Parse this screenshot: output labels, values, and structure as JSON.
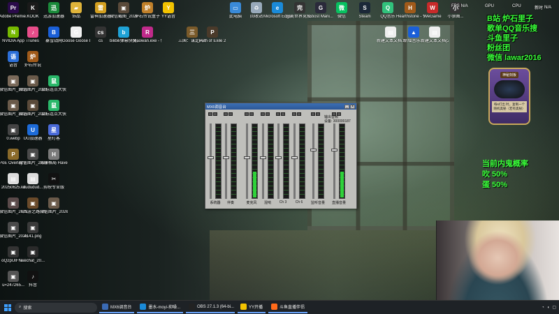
{
  "desktop_icons_col1": [
    {
      "label": "Adobe Premie...",
      "icon": "premiere-icon",
      "color": "#2a0a4a",
      "glyph": "Pr"
    },
    {
      "label": "NVIDIA App",
      "icon": "nvidia-icon",
      "color": "#76b900",
      "glyph": "N"
    },
    {
      "label": "语音",
      "icon": "voice-icon",
      "color": "#2c6fd8",
      "glyph": "语"
    },
    {
      "label": "微信图片_2025072...",
      "icon": "image-icon",
      "color": "#7a6a5a",
      "glyph": "▣"
    },
    {
      "label": "微信图片_2025072...",
      "icon": "image-icon",
      "color": "#6a5a4a",
      "glyph": "▣"
    },
    {
      "label": "0.webp",
      "icon": "webp-icon",
      "color": "#444",
      "glyph": "▣"
    },
    {
      "label": "PoE Overlay II Standal...",
      "icon": "poe-overlay-icon",
      "color": "#8a6a2a",
      "glyph": "P"
    },
    {
      "label": "20250625.kx",
      "icon": "file-icon",
      "color": "#ddd",
      "glyph": "▤"
    },
    {
      "label": "微信图片_2025062...",
      "icon": "image-icon",
      "color": "#5a4a4a",
      "glyph": "▣"
    },
    {
      "label": "微信图片_2025091...",
      "icon": "image-icon",
      "color": "#4a4a4a",
      "glyph": "▣"
    },
    {
      "label": "oQ2pUIFN...",
      "icon": "image-icon",
      "color": "#333",
      "glyph": "▣"
    },
    {
      "label": "u=247265...",
      "icon": "image-icon",
      "color": "#555",
      "glyph": "▣"
    }
  ],
  "desktop_icons_col2": [
    {
      "label": "KOOK",
      "icon": "kook-icon",
      "color": "#1a1a1a",
      "glyph": "K"
    },
    {
      "label": "iTunes",
      "icon": "itunes-icon",
      "color": "#e84d8a",
      "glyph": "♪"
    },
    {
      "label": "炉石传说",
      "icon": "hearthstone-icon",
      "color": "#a05a1a",
      "glyph": "炉"
    },
    {
      "label": "微信图片_2025072...",
      "icon": "image-icon",
      "color": "#6a5a4a",
      "glyph": "▣"
    },
    {
      "label": "微信图片_2025072...",
      "icon": "image-icon",
      "color": "#5a4a3a",
      "glyph": "▣"
    },
    {
      "label": "UU加速器",
      "icon": "uu-accelerator-icon",
      "color": "#1d6bd8",
      "glyph": "U"
    },
    {
      "label": "微信图片_2025071...",
      "icon": "image-icon",
      "color": "#4a4a4a",
      "glyph": "▣"
    },
    {
      "label": "dududud...",
      "icon": "file-icon",
      "color": "#ddd",
      "glyph": "▤"
    },
    {
      "label": "《西游之路: 降临》预先...",
      "icon": "image-icon",
      "color": "#6a4a2a",
      "glyph": "▣"
    },
    {
      "label": "4141.png",
      "icon": "image-icon",
      "color": "#3a3a3a",
      "glyph": "▣"
    },
    {
      "label": "wechat_20...",
      "icon": "image-icon",
      "color": "#2a2a2a",
      "glyph": "▣"
    },
    {
      "label": "抖音",
      "icon": "douyin-icon",
      "color": "#111",
      "glyph": "♪"
    }
  ],
  "desktop_icons_col3": [
    {
      "label": "迅游加速器",
      "icon": "xunyou-icon",
      "color": "#1a8a3a",
      "glyph": "迅"
    },
    {
      "label": "暴雪战网",
      "icon": "battlenet-icon",
      "color": "#1a5fd8",
      "glyph": "B"
    },
    {
      "label": "鼠标连点大侠",
      "icon": "mouse-clicker-icon",
      "color": "#2ab86a",
      "glyph": "鼠"
    },
    {
      "label": "鼠标连点大侠",
      "icon": "mouse-clicker-icon",
      "color": "#2ab86a",
      "glyph": "鼠"
    },
    {
      "label": "星盯客",
      "icon": "app-icon",
      "color": "#4a6ad8",
      "glyph": "星"
    },
    {
      "label": "海康格局 Havendock",
      "icon": "havendock-icon",
      "color": "#7a7a7a",
      "glyph": "H"
    },
    {
      "label": "剪映专业版",
      "icon": "capcut-icon",
      "color": "#111",
      "glyph": "✂"
    },
    {
      "label": "微信图片_2026022...",
      "icon": "image-icon",
      "color": "#6a5a4a",
      "glyph": "▣"
    }
  ],
  "desktop_icons_row_top": [
    {
      "label": "饰品",
      "icon": "folder-icon",
      "color": "#e0b43a",
      "glyph": "▰"
    },
    {
      "label": "Goose Goose Duck",
      "icon": "goose-icon",
      "color": "#f0f0f0",
      "glyph": "G"
    },
    {
      "label": "雷神加速器",
      "icon": "leishen-icon",
      "color": "#d4a020",
      "glyph": "雷"
    },
    {
      "label": "cs",
      "icon": "cs-icon",
      "color": "#333",
      "glyph": "cs"
    },
    {
      "label": "微信截图_2024071...",
      "icon": "image-icon",
      "color": "#5a4a3a",
      "glyph": "▣"
    },
    {
      "label": "bilibili弹幕快捷方式",
      "icon": "bilibili-icon",
      "color": "#1fa2d6",
      "glyph": "b"
    },
    {
      "label": "炉石传说盒子",
      "icon": "hearthstone-box-icon",
      "color": "#c0802a",
      "glyph": "炉"
    },
    {
      "label": "xiaowan.exe - 快捷方式",
      "icon": "xiaowan-icon",
      "color": "#c02a8a",
      "glyph": "R"
    },
    {
      "label": "YY语音",
      "icon": "yy-icon",
      "color": "#f2c200",
      "glyph": "Y"
    },
    {
      "label": "三国：谋定天下",
      "icon": "sanguo-icon",
      "color": "#7a5a2a",
      "glyph": "三"
    },
    {
      "label": "Path of Exile 2",
      "icon": "poe2-icon",
      "color": "#4a3a2a",
      "glyph": "P"
    }
  ],
  "desktop_icons_right": [
    {
      "label": "此电脑",
      "icon": "this-pc-icon",
      "color": "#3a8ad8",
      "glyph": "▭"
    },
    {
      "label": "回收站",
      "icon": "recycle-bin-icon",
      "color": "#9ab",
      "glyph": "♻"
    },
    {
      "label": "Microsoft Edge",
      "icon": "edge-icon",
      "color": "#1a8ad8",
      "glyph": "e"
    },
    {
      "label": "完美世界竞技...",
      "icon": "perfect-world-icon",
      "color": "#333",
      "glyph": "完"
    },
    {
      "label": "Ghost Mani...",
      "icon": "app-icon",
      "color": "#2a2a3a",
      "glyph": "G"
    },
    {
      "label": "微信",
      "icon": "wechat-icon",
      "color": "#07c160",
      "glyph": "微"
    },
    {
      "label": "Steam",
      "icon": "steam-icon",
      "color": "#1b2838",
      "glyph": "S"
    },
    {
      "label": "QQ音乐",
      "icon": "qq-music-icon",
      "color": "#31c27c",
      "glyph": "Q"
    },
    {
      "label": "Hearthstone - 快捷方式",
      "icon": "hearthstone-icon",
      "color": "#a05a1a",
      "glyph": "H"
    },
    {
      "label": "WeGame",
      "icon": "wegame-icon",
      "color": "#c82a2a",
      "glyph": "W"
    },
    {
      "label": "小狼图...",
      "icon": "app-icon",
      "color": "#333",
      "glyph": "小"
    },
    {
      "label": "新建文本文档.txt",
      "icon": "text-file-icon",
      "color": "#eee",
      "glyph": "▤"
    },
    {
      "label": "新增音乐...",
      "icon": "app-icon",
      "color": "#1a5fd8",
      "glyph": "▲"
    },
    {
      "label": "新建文本文档(2).txt",
      "icon": "text-file-icon",
      "color": "#eee",
      "glyph": "▤"
    }
  ],
  "mixer": {
    "title": "MX6调音台",
    "min": "_",
    "close": "X",
    "device_label": "输出音频",
    "device_value": "设备: 300000187",
    "strips": [
      {
        "label": "系统器",
        "level": 0.0,
        "fader": 0.55
      },
      {
        "label": "伴奏",
        "level": 0.0,
        "fader": 0.55
      },
      {
        "label": "麦克风",
        "level": 0.35,
        "fader": 0.55
      },
      {
        "label": "混响",
        "level": 0.0,
        "fader": 0.55
      },
      {
        "label": "Ch 3",
        "level": 0.0,
        "fader": 0.55
      },
      {
        "label": "Ch 6",
        "level": 0.0,
        "fader": 0.55
      },
      {
        "label": "监听音量",
        "level": 0.0,
        "fader": 0.65
      },
      {
        "label": "直播音量",
        "level": 0.35,
        "fader": 0.65
      }
    ]
  },
  "overlay": {
    "lines": [
      "B站 炉石里子",
      "歌单QQ音乐搜",
      "斗鱼里子",
      "粉丝团",
      "微信  lawar2016"
    ],
    "prob_title": "当前内鬼概率",
    "prob_lines": [
      "吹 50%",
      "蛋 50%"
    ],
    "card_name": "神秘刻板",
    "card_text": "每6打出 时，复制一个随机奥秘（若有奥秘）"
  },
  "sysinfo": {
    "fps": "FPS",
    "fps_val": "N/A",
    "gpu": "GPU",
    "cpu": "CPU",
    "extra": "新时",
    "na": "N/A"
  },
  "taskbar": {
    "search_placeholder": "搜索",
    "tasks": [
      {
        "label": "MX6调音台",
        "icon": "mixer-task-icon",
        "color": "#3a6ab4"
      },
      {
        "label": "墨水-moyi-抑噪...",
        "icon": "edge-task-icon",
        "color": "#1a8ad8"
      },
      {
        "label": "OBS 27.1.3 (64-bi...",
        "icon": "obs-task-icon",
        "color": "#222"
      },
      {
        "label": "YY开播",
        "icon": "yy-task-icon",
        "color": "#f2c200"
      },
      {
        "label": "斗鱼直播伴侣",
        "icon": "douyu-task-icon",
        "color": "#ff6a1a"
      }
    ]
  }
}
